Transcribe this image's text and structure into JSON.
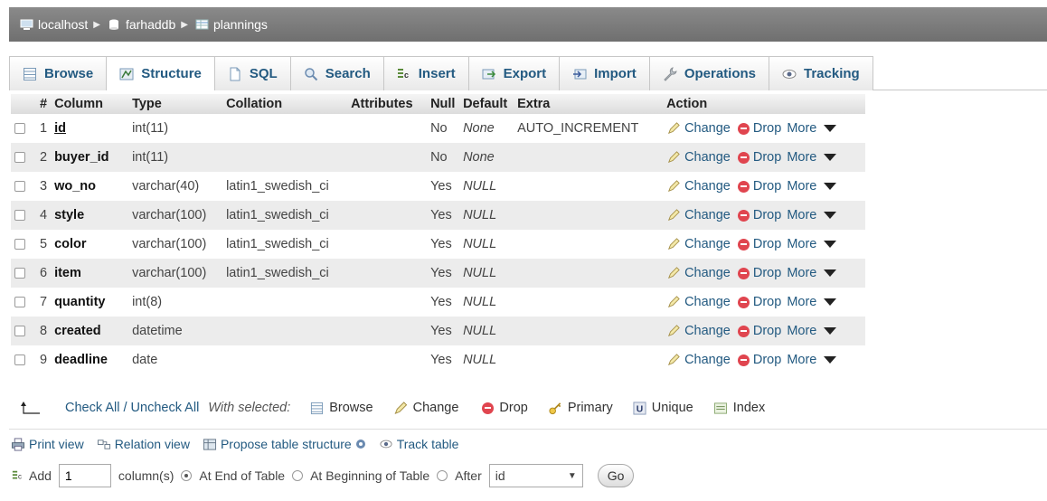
{
  "breadcrumb": [
    {
      "label": "localhost",
      "icon": "server-icon"
    },
    {
      "label": "farhaddb",
      "icon": "database-icon"
    },
    {
      "label": "plannings",
      "icon": "table-icon"
    }
  ],
  "tabs": [
    {
      "label": "Browse",
      "icon": "browse-icon"
    },
    {
      "label": "Structure",
      "icon": "structure-icon",
      "active": true
    },
    {
      "label": "SQL",
      "icon": "sql-icon"
    },
    {
      "label": "Search",
      "icon": "search-icon"
    },
    {
      "label": "Insert",
      "icon": "insert-icon"
    },
    {
      "label": "Export",
      "icon": "export-icon"
    },
    {
      "label": "Import",
      "icon": "import-icon"
    },
    {
      "label": "Operations",
      "icon": "wrench-icon"
    },
    {
      "label": "Tracking",
      "icon": "eye-icon"
    }
  ],
  "table": {
    "headers": {
      "num": "#",
      "column": "Column",
      "type": "Type",
      "collation": "Collation",
      "attributes": "Attributes",
      "null": "Null",
      "default": "Default",
      "extra": "Extra",
      "action": "Action"
    },
    "rows": [
      {
        "num": "1",
        "name": "id",
        "type": "int(11)",
        "collation": "",
        "attributes": "",
        "null": "No",
        "default": "None",
        "extra": "AUTO_INCREMENT",
        "primary": true
      },
      {
        "num": "2",
        "name": "buyer_id",
        "type": "int(11)",
        "collation": "",
        "attributes": "",
        "null": "No",
        "default": "None",
        "extra": ""
      },
      {
        "num": "3",
        "name": "wo_no",
        "type": "varchar(40)",
        "collation": "latin1_swedish_ci",
        "attributes": "",
        "null": "Yes",
        "default": "NULL",
        "extra": ""
      },
      {
        "num": "4",
        "name": "style",
        "type": "varchar(100)",
        "collation": "latin1_swedish_ci",
        "attributes": "",
        "null": "Yes",
        "default": "NULL",
        "extra": ""
      },
      {
        "num": "5",
        "name": "color",
        "type": "varchar(100)",
        "collation": "latin1_swedish_ci",
        "attributes": "",
        "null": "Yes",
        "default": "NULL",
        "extra": ""
      },
      {
        "num": "6",
        "name": "item",
        "type": "varchar(100)",
        "collation": "latin1_swedish_ci",
        "attributes": "",
        "null": "Yes",
        "default": "NULL",
        "extra": ""
      },
      {
        "num": "7",
        "name": "quantity",
        "type": "int(8)",
        "collation": "",
        "attributes": "",
        "null": "Yes",
        "default": "NULL",
        "extra": ""
      },
      {
        "num": "8",
        "name": "created",
        "type": "datetime",
        "collation": "",
        "attributes": "",
        "null": "Yes",
        "default": "NULL",
        "extra": ""
      },
      {
        "num": "9",
        "name": "deadline",
        "type": "date",
        "collation": "",
        "attributes": "",
        "null": "Yes",
        "default": "NULL",
        "extra": ""
      }
    ],
    "actions": {
      "change": "Change",
      "drop": "Drop",
      "more": "More"
    }
  },
  "checkall": {
    "label": "Check All / Uncheck All",
    "with_selected": "With selected:",
    "actions": [
      {
        "label": "Browse",
        "icon": "browse-icon"
      },
      {
        "label": "Change",
        "icon": "pencil-icon"
      },
      {
        "label": "Drop",
        "icon": "drop-icon"
      },
      {
        "label": "Primary",
        "icon": "key-icon"
      },
      {
        "label": "Unique",
        "icon": "unique-icon"
      },
      {
        "label": "Index",
        "icon": "index-icon"
      }
    ]
  },
  "tools": {
    "print_view": "Print view",
    "relation_view": "Relation view",
    "propose": "Propose table structure",
    "track": "Track table"
  },
  "add": {
    "label": "Add",
    "count": "1",
    "columns": "column(s)",
    "at_end": "At End of Table",
    "at_begin": "At Beginning of Table",
    "after": "After",
    "after_value": "id",
    "go": "Go"
  },
  "colors": {
    "link": "#235a81",
    "crumbbar": "#7a7a7a",
    "drop": "#e0454f"
  }
}
